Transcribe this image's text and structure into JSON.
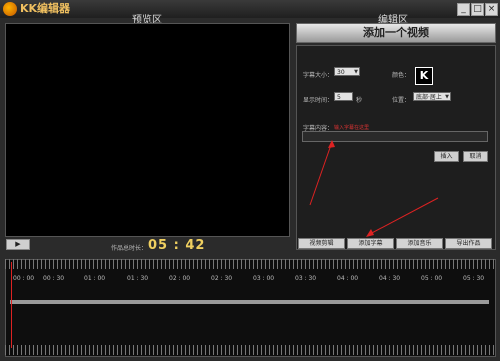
{
  "window": {
    "title": "KK编辑器",
    "controls": [
      "_",
      "□",
      "×"
    ]
  },
  "preview": {
    "zone_label": "预览区",
    "play_label": "▶",
    "duration_label": "作品总时长：",
    "duration_value": "05 : 42"
  },
  "editor": {
    "zone_label": "编辑区",
    "add_video_label": "添加一个视频",
    "font_size_label": "字幕大小：",
    "font_size_value": "30",
    "color_label": "颜色：",
    "color_swatch_text": "K",
    "display_time_label": "显示时间：",
    "display_time_value": "5",
    "display_time_unit": "秒",
    "position_label": "位置：",
    "position_value": "底部·居上",
    "content_label": "字幕内容：",
    "content_hint": "输入字幕在这里",
    "content_value": "",
    "insert_label": "插入",
    "cancel_label": "取消",
    "tabs": [
      "视频剪辑",
      "添加字幕",
      "添加音乐",
      "导出作品"
    ]
  },
  "timeline": {
    "ticks": [
      "00 : 00",
      "00 : 30",
      "01 : 00",
      "01 : 30",
      "02 : 00",
      "02 : 30",
      "03 : 00",
      "03 : 30",
      "04 : 00",
      "04 : 30",
      "05 : 00",
      "05 : 30"
    ]
  },
  "colors": {
    "accent_red": "#dd2222",
    "duration_yellow": "#f0d060"
  }
}
